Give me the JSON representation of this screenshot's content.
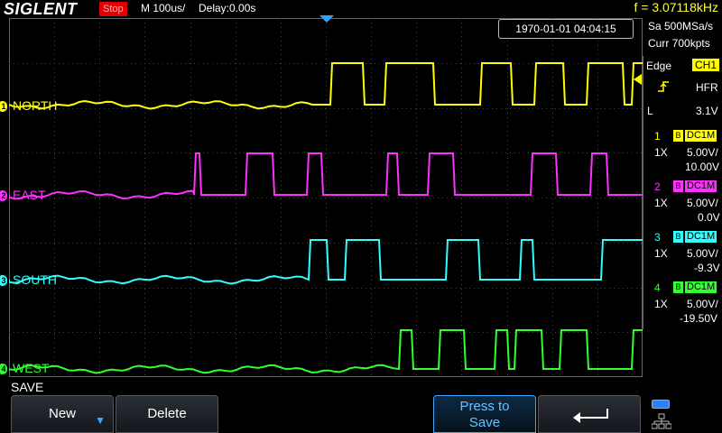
{
  "topbar": {
    "logo": "SIGLENT",
    "run_state": "Stop",
    "timebase": "M 100us/",
    "delay": "Delay:0.00s",
    "frequency": "f = 3.07118kHz",
    "datetime": "1970-01-01 04:04:15"
  },
  "acquisition": {
    "sample_rate": "Sa 500MSa/s",
    "memory_depth": "Curr 700kpts"
  },
  "trigger": {
    "label": "Edge",
    "source": "CH1",
    "slope_icon": "rising-edge-icon",
    "coupling": "HFR",
    "level_label": "L",
    "level": "3.1V"
  },
  "channels": [
    {
      "num": "1",
      "name": "NORTH",
      "coupling": "DC1M",
      "probe": "1X",
      "scale": "5.00V/",
      "offset": "10.00V",
      "color": "#ffff00",
      "bw_label": "B"
    },
    {
      "num": "2",
      "name": "EAST",
      "coupling": "DC1M",
      "probe": "1X",
      "scale": "5.00V/",
      "offset": "0.0V",
      "color": "#ff30ff",
      "bw_label": "B"
    },
    {
      "num": "3",
      "name": "SOUTH",
      "coupling": "DC1M",
      "probe": "1X",
      "scale": "5.00V/",
      "offset": "-9.3V",
      "color": "#30ffff",
      "bw_label": "B"
    },
    {
      "num": "4",
      "name": "WEST",
      "coupling": "DC1M",
      "probe": "1X",
      "scale": "5.00V/",
      "offset": "-19.50V",
      "color": "#30ff30",
      "bw_label": "B"
    }
  ],
  "menu": {
    "title": "SAVE",
    "new_label": "New",
    "delete_label": "Delete",
    "press_to_save_line1": "Press to",
    "press_to_save_line2": "Save",
    "back_icon": "return-arrow-icon"
  },
  "status_icons": [
    "usb-icon",
    "network-icon"
  ]
}
